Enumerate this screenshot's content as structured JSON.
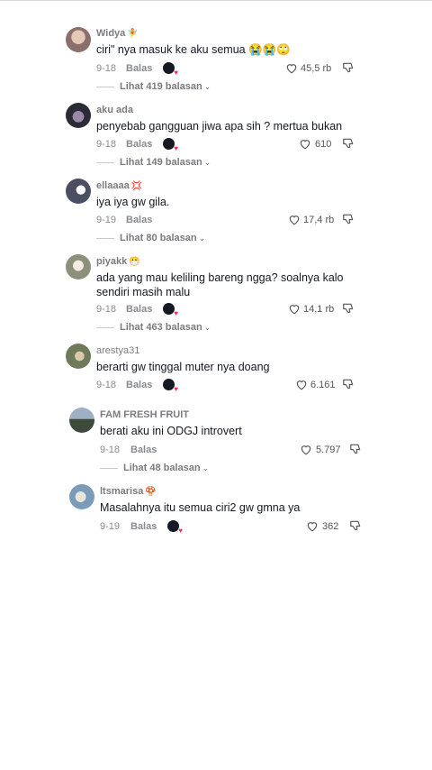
{
  "comments": [
    {
      "username": "Widya",
      "badge": "🧚",
      "text": "ciri\" nya masuk ke aku semua 😭😭🙄",
      "date": "9-18",
      "reply_label": "Balas",
      "likes": "45,5 rb",
      "view_replies": "Lihat 419 balasan",
      "creator_liked": true
    },
    {
      "username": "aku ada",
      "badge": "",
      "text": "penyebab gangguan jiwa apa sih ? mertua bukan",
      "date": "9-18",
      "reply_label": "Balas",
      "likes": "610",
      "view_replies": "Lihat 149 balasan",
      "creator_liked": true
    },
    {
      "username": "ellaaaa",
      "badge": "💢",
      "text": "iya iya gw gila.",
      "date": "9-19",
      "reply_label": "Balas",
      "likes": "17,4 rb",
      "view_replies": "Lihat 80 balasan",
      "creator_liked": false
    },
    {
      "username": "piyakk",
      "badge": "😷",
      "text": "ada yang mau keliling bareng ngga? soalnya kalo sendiri masih malu",
      "date": "9-18",
      "reply_label": "Balas",
      "likes": "14,1 rb",
      "view_replies": "Lihat 463 balasan",
      "creator_liked": true
    },
    {
      "username": "arestya31",
      "badge": "",
      "text": "berarti gw tinggal muter nya doang",
      "date": "9-18",
      "reply_label": "Balas",
      "likes": "6.161",
      "view_replies": "",
      "creator_liked": true
    },
    {
      "username": "FAM FRESH FRUIT",
      "badge": "",
      "text": "berati aku ini ODGJ introvert",
      "date": "9-18",
      "reply_label": "Balas",
      "likes": "5.797",
      "view_replies": "Lihat 48 balasan",
      "creator_liked": false
    },
    {
      "username": "ltsmarisa",
      "badge": "🍄",
      "text": "Masalahnya itu semua ciri2 gw gmna ya",
      "date": "9-19",
      "reply_label": "Balas",
      "likes": "362",
      "view_replies": "",
      "creator_liked": true
    }
  ],
  "colors": {
    "avatar_1": "#8a6f6a",
    "avatar_2": "#2b2b35",
    "avatar_3": "#4a4f63",
    "avatar_4": "#8c8f7a",
    "avatar_5": "#6e7a5a",
    "avatar_6": "#56657a",
    "avatar_7": "#7a9cb8",
    "heart": "#fe2c55"
  },
  "icons": {
    "like": "heart-outline-icon",
    "dislike": "thumbs-down-icon",
    "creator_like": "creator-liked-icon",
    "chevron": "chevron-down-icon"
  }
}
